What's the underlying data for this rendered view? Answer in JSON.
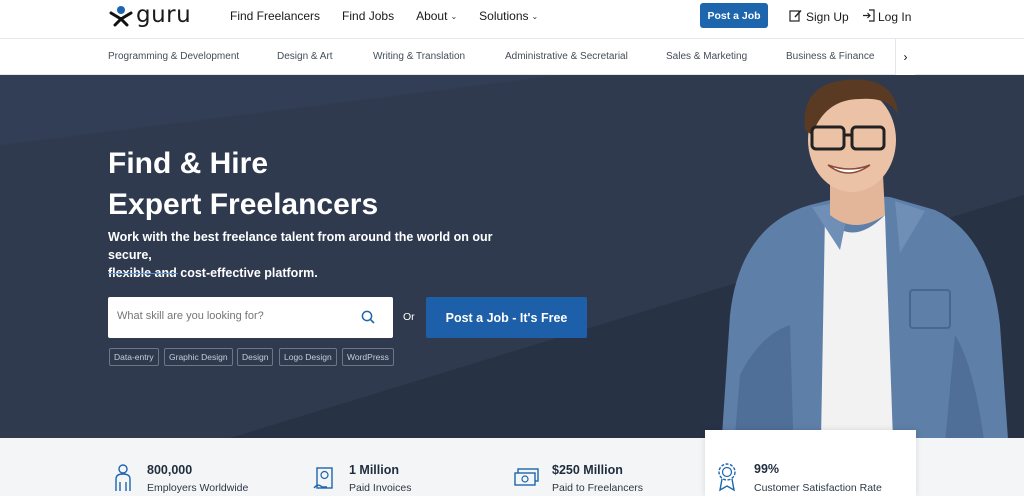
{
  "brand": {
    "name": "guru",
    "accent": "#1d66ad"
  },
  "nav": {
    "links": [
      {
        "label": "Find Freelancers",
        "caret": ""
      },
      {
        "label": "Find Jobs",
        "caret": ""
      },
      {
        "label": "About",
        "caret": "⌄"
      },
      {
        "label": "Solutions",
        "caret": "⌄"
      }
    ],
    "post_job": "Post a Job",
    "sign_up": "Sign Up",
    "log_in": "Log In"
  },
  "categories": [
    "Programming & Development",
    "Design & Art",
    "Writing & Translation",
    "Administrative & Secretarial",
    "Sales & Marketing",
    "Business & Finance"
  ],
  "hero": {
    "title_line1": "Find & Hire",
    "title_line2": "Expert Freelancers",
    "subtitle_line1": "Work with the best freelance talent from around the world on our secure,",
    "subtitle_line2": "flexible and cost-effective platform.",
    "search_placeholder": "What skill are you looking for?",
    "or": "Or",
    "post_cta": "Post a Job - It's Free",
    "tags": [
      "Data-entry",
      "Graphic Design",
      "Design",
      "Logo Design",
      "WordPress"
    ]
  },
  "stats": [
    {
      "value": "800,000",
      "label": "Employers Worldwide",
      "icon": "person-icon"
    },
    {
      "value": "1 Million",
      "label": "Paid Invoices",
      "icon": "invoice-icon"
    },
    {
      "value": "$250 Million",
      "label": "Paid to Freelancers",
      "icon": "money-icon"
    },
    {
      "value": "99%",
      "label": "Customer Satisfaction Rate",
      "icon": "award-icon"
    }
  ]
}
